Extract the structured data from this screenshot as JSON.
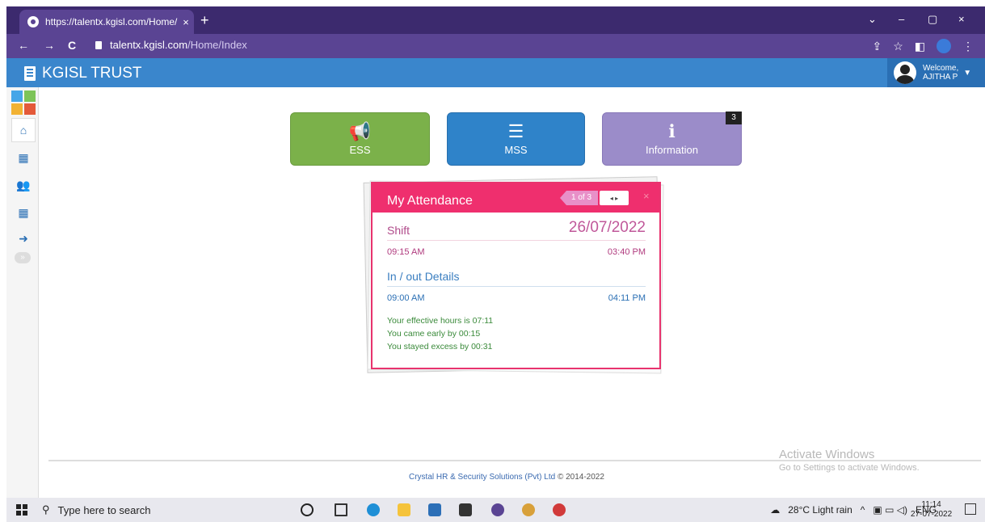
{
  "browser": {
    "tab_title": "https://talentx.kgisl.com/Home/I",
    "tab_close": "×",
    "new_tab": "+",
    "url_host": "talentx.kgisl.com",
    "url_path": "/Home/Index",
    "back": "←",
    "forward": "→",
    "reload": "C",
    "window_controls": [
      "⌄",
      "–",
      "▢",
      "×"
    ],
    "addr_icons": [
      "⇪",
      "☆",
      "◧",
      "⋮"
    ]
  },
  "app": {
    "brand": "KGISL TRUST",
    "welcome_line1": "Welcome,",
    "welcome_line2": "AJITHA P"
  },
  "sidebar": {
    "items": [
      {
        "name": "home",
        "glyph": "⌂"
      },
      {
        "name": "calendar",
        "glyph": "▦"
      },
      {
        "name": "users",
        "glyph": "👥"
      },
      {
        "name": "calendar2",
        "glyph": "▦"
      },
      {
        "name": "logout",
        "glyph": "➜"
      }
    ],
    "collapse_glyph": "»"
  },
  "tiles": [
    {
      "label": "ESS",
      "glyph": "📢",
      "color": "#7bb14a"
    },
    {
      "label": "MSS",
      "glyph": "☰",
      "color": "#2f83c9"
    },
    {
      "label": "Information",
      "glyph": "ℹ",
      "color": "#9b8cc9"
    }
  ],
  "info_badge": "3",
  "attendance": {
    "title": "My Attendance",
    "pager": "1 of 3",
    "arrows": "◂ ▸",
    "close": "×",
    "shift_label": "Shift",
    "date": "26/07/2022",
    "shift_start": "09:15 AM",
    "shift_end": "03:40 PM",
    "inout_label": "In / out Details",
    "in_time": "09:00 AM",
    "out_time": "04:11 PM",
    "summary": [
      "Your effective hours is 07:11",
      "You came early by 00:15",
      "You stayed excess by 00:31"
    ]
  },
  "footer": {
    "company": "Crystal HR & Security Solutions (Pvt) Ltd",
    "copyright": "© 2014-2022"
  },
  "watermark": {
    "line1": "Activate Windows",
    "line2": "Go to Settings to activate Windows."
  },
  "taskbar": {
    "search_placeholder": "Type here to search",
    "weather": "28°C  Light rain",
    "lang": "ENG",
    "time": "11:14",
    "date": "27-07-2022"
  }
}
